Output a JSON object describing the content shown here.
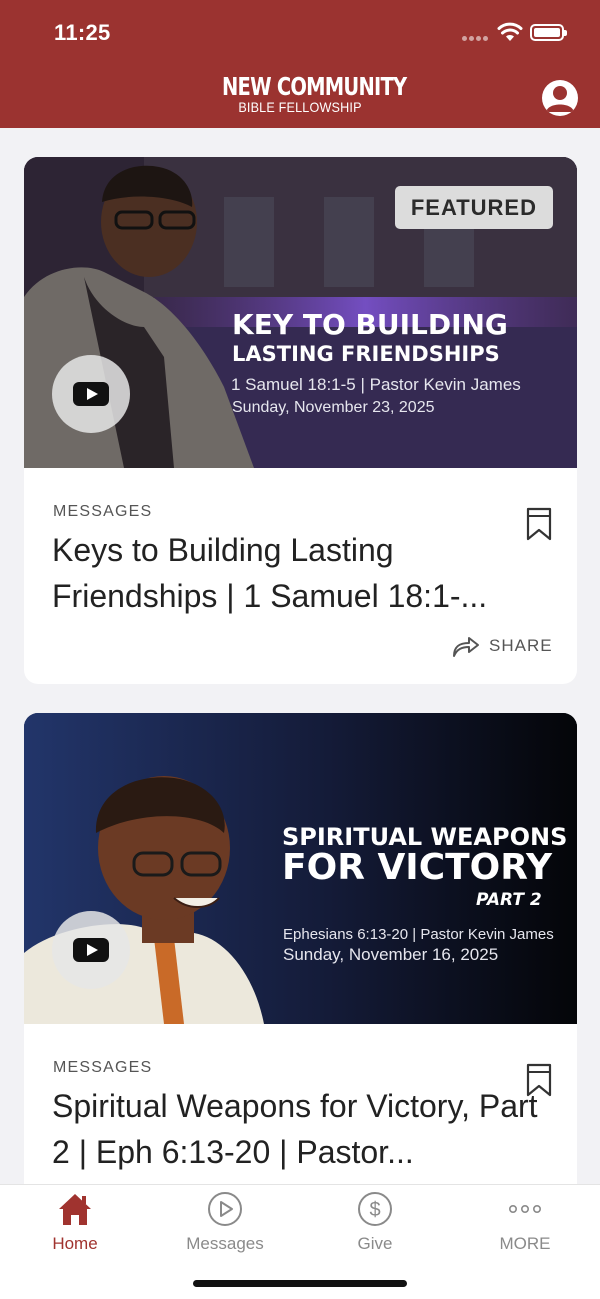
{
  "status_bar": {
    "time": "11:25"
  },
  "header": {
    "logo_line1": "NEW COMMUNITY",
    "logo_line2": "BIBLE FELLOWSHIP",
    "profile_icon": "person-icon",
    "brand_color": "#9b3330"
  },
  "cards": [
    {
      "badge": "FEATURED",
      "thumb_title_line1": "KEY TO BUILDING",
      "thumb_title_line2": "LASTING FRIENDSHIPS",
      "thumb_meta_line1": "1 Samuel 18:1-5 | Pastor Kevin James",
      "thumb_meta_line2": "Sunday, November 23, 2025",
      "category": "MESSAGES",
      "title": "Keys to Building Lasting Friendships | 1 Samuel 18:1-...",
      "share_label": "SHARE"
    },
    {
      "thumb_title_line1": "SPIRITUAL WEAPONS",
      "thumb_title_line2": "FOR VICTORY",
      "thumb_title_line3": "PART 2",
      "thumb_meta_line1": "Ephesians 6:13-20 | Pastor Kevin James",
      "thumb_meta_line2": "Sunday, November 16, 2025",
      "category": "MESSAGES",
      "title": "Spiritual Weapons for Victory, Part 2 | Eph 6:13-20 | Pastor..."
    }
  ],
  "tabbar": {
    "items": [
      {
        "label": "Home",
        "icon": "home-icon",
        "active": true
      },
      {
        "label": "Messages",
        "icon": "play-circle-icon",
        "active": false
      },
      {
        "label": "Give",
        "icon": "dollar-circle-icon",
        "active": false
      },
      {
        "label": "MORE",
        "icon": "more-dots-icon",
        "active": false
      }
    ],
    "active_color": "#a0332f"
  }
}
